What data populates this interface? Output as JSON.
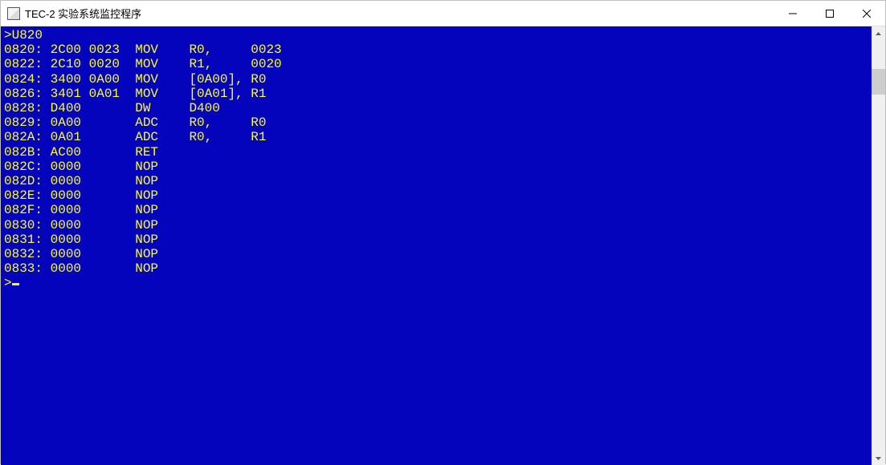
{
  "title": "TEC-2 实验系统监控程序",
  "window_controls": {
    "minimize": "minimize",
    "maximize": "maximize",
    "close": "close"
  },
  "terminal": {
    "prompt_char": ">",
    "input_command": "U820",
    "final_prompt": ">",
    "lines": [
      {
        "addr": "0820",
        "words": "2C00 0023",
        "mnem": "MOV",
        "op1": "R0,",
        "op2": "0023"
      },
      {
        "addr": "0822",
        "words": "2C10 0020",
        "mnem": "MOV",
        "op1": "R1,",
        "op2": "0020"
      },
      {
        "addr": "0824",
        "words": "3400 0A00",
        "mnem": "MOV",
        "op1": "[0A00],",
        "op2": "R0"
      },
      {
        "addr": "0826",
        "words": "3401 0A01",
        "mnem": "MOV",
        "op1": "[0A01],",
        "op2": "R1"
      },
      {
        "addr": "0828",
        "words": "D400",
        "mnem": "DW",
        "op1": "D400",
        "op2": ""
      },
      {
        "addr": "0829",
        "words": "0A00",
        "mnem": "ADC",
        "op1": "R0,",
        "op2": "R0"
      },
      {
        "addr": "082A",
        "words": "0A01",
        "mnem": "ADC",
        "op1": "R0,",
        "op2": "R1"
      },
      {
        "addr": "082B",
        "words": "AC00",
        "mnem": "RET",
        "op1": "",
        "op2": ""
      },
      {
        "addr": "082C",
        "words": "0000",
        "mnem": "NOP",
        "op1": "",
        "op2": ""
      },
      {
        "addr": "082D",
        "words": "0000",
        "mnem": "NOP",
        "op1": "",
        "op2": ""
      },
      {
        "addr": "082E",
        "words": "0000",
        "mnem": "NOP",
        "op1": "",
        "op2": ""
      },
      {
        "addr": "082F",
        "words": "0000",
        "mnem": "NOP",
        "op1": "",
        "op2": ""
      },
      {
        "addr": "0830",
        "words": "0000",
        "mnem": "NOP",
        "op1": "",
        "op2": ""
      },
      {
        "addr": "0831",
        "words": "0000",
        "mnem": "NOP",
        "op1": "",
        "op2": ""
      },
      {
        "addr": "0832",
        "words": "0000",
        "mnem": "NOP",
        "op1": "",
        "op2": ""
      },
      {
        "addr": "0833",
        "words": "0000",
        "mnem": "NOP",
        "op1": "",
        "op2": ""
      }
    ]
  }
}
